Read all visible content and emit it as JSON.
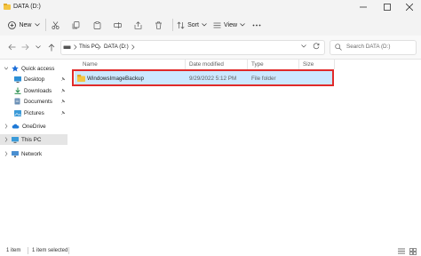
{
  "window": {
    "title": "DATA (D:)"
  },
  "toolbar": {
    "new_label": "New",
    "sort_label": "Sort",
    "view_label": "View"
  },
  "address": {
    "segments": [
      "This PC",
      "DATA (D:)"
    ]
  },
  "search": {
    "placeholder": "Search DATA (D:)"
  },
  "nav": {
    "quick_access": "Quick access",
    "desktop": "Desktop",
    "downloads": "Downloads",
    "documents": "Documents",
    "pictures": "Pictures",
    "onedrive": "OneDrive",
    "this_pc": "This PC",
    "network": "Network"
  },
  "columns": {
    "name": "Name",
    "date": "Date modified",
    "type": "Type",
    "size": "Size"
  },
  "files": [
    {
      "name": "WindowsImageBackup",
      "date": "9/29/2022 5:12 PM",
      "type": "File folder",
      "size": "",
      "selected": true
    }
  ],
  "status": {
    "item_count": "1 item",
    "selected": "1 item selected"
  },
  "colors": {
    "selection": "#cce8ff",
    "highlight_border": "#e02a2a",
    "folder": "#f4c542"
  }
}
